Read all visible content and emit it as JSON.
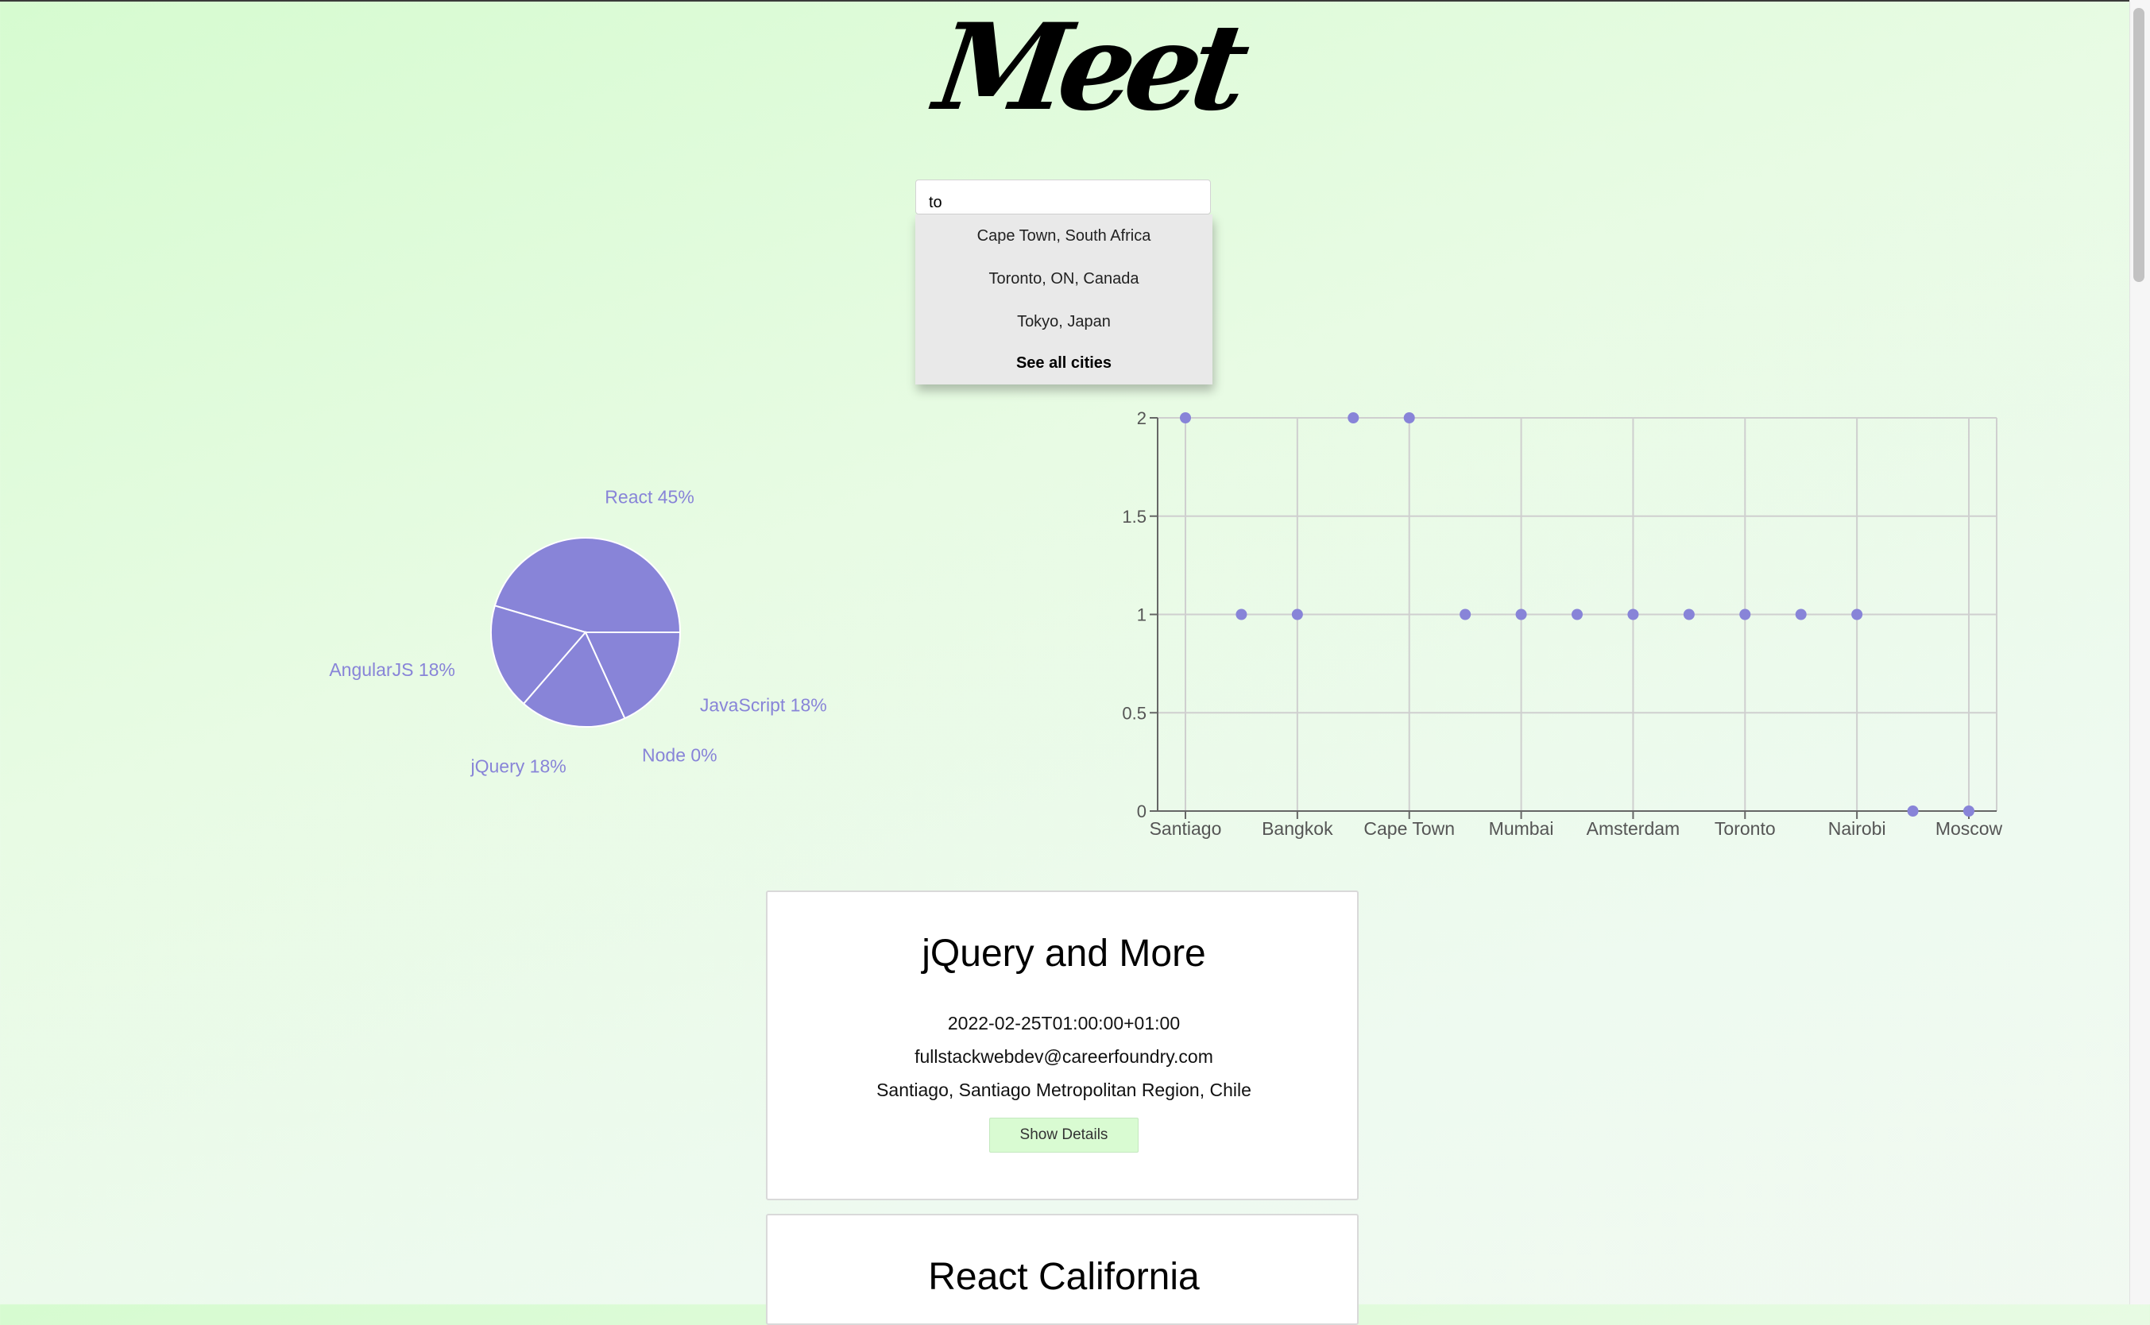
{
  "app": {
    "logo_text": "Meet"
  },
  "search": {
    "value": "to",
    "suggestions": [
      "Cape Town, South Africa",
      "Toronto, ON, Canada",
      "Tokyo, Japan"
    ],
    "see_all_label": "See all cities"
  },
  "colors": {
    "accent": "#8884d8",
    "button_bg": "#d9fbd2"
  },
  "chart_data": [
    {
      "type": "pie",
      "title": "",
      "slices": [
        {
          "label": "React",
          "value": 45,
          "display": "React 45%"
        },
        {
          "label": "AngularJS",
          "value": 18,
          "display": "AngularJS 18%"
        },
        {
          "label": "jQuery",
          "value": 18,
          "display": "jQuery 18%"
        },
        {
          "label": "Node",
          "value": 0,
          "display": "Node 0%"
        },
        {
          "label": "JavaScript",
          "value": 18,
          "display": "JavaScript 18%"
        }
      ]
    },
    {
      "type": "scatter",
      "title": "",
      "xlabel": "",
      "ylabel": "",
      "ylim": [
        0,
        2
      ],
      "yticks": [
        "0",
        "0.5",
        "1",
        "1.5",
        "2"
      ],
      "grid": true,
      "x_tick_labels": [
        "Santiago",
        "Bangkok",
        "Cape Town",
        "Mumbai",
        "Amsterdam",
        "Toronto",
        "Nairobi",
        "Moscow"
      ],
      "values": [
        2,
        1,
        1,
        2,
        2,
        1,
        1,
        1,
        1,
        1,
        1,
        1,
        1,
        0,
        0
      ]
    }
  ],
  "events": [
    {
      "title": "jQuery and More",
      "date": "2022-02-25T01:00:00+01:00",
      "email": "fullstackwebdev@careerfoundry.com",
      "location": "Santiago, Santiago Metropolitan Region, Chile",
      "button_label": "Show Details"
    },
    {
      "title": "React California"
    }
  ]
}
